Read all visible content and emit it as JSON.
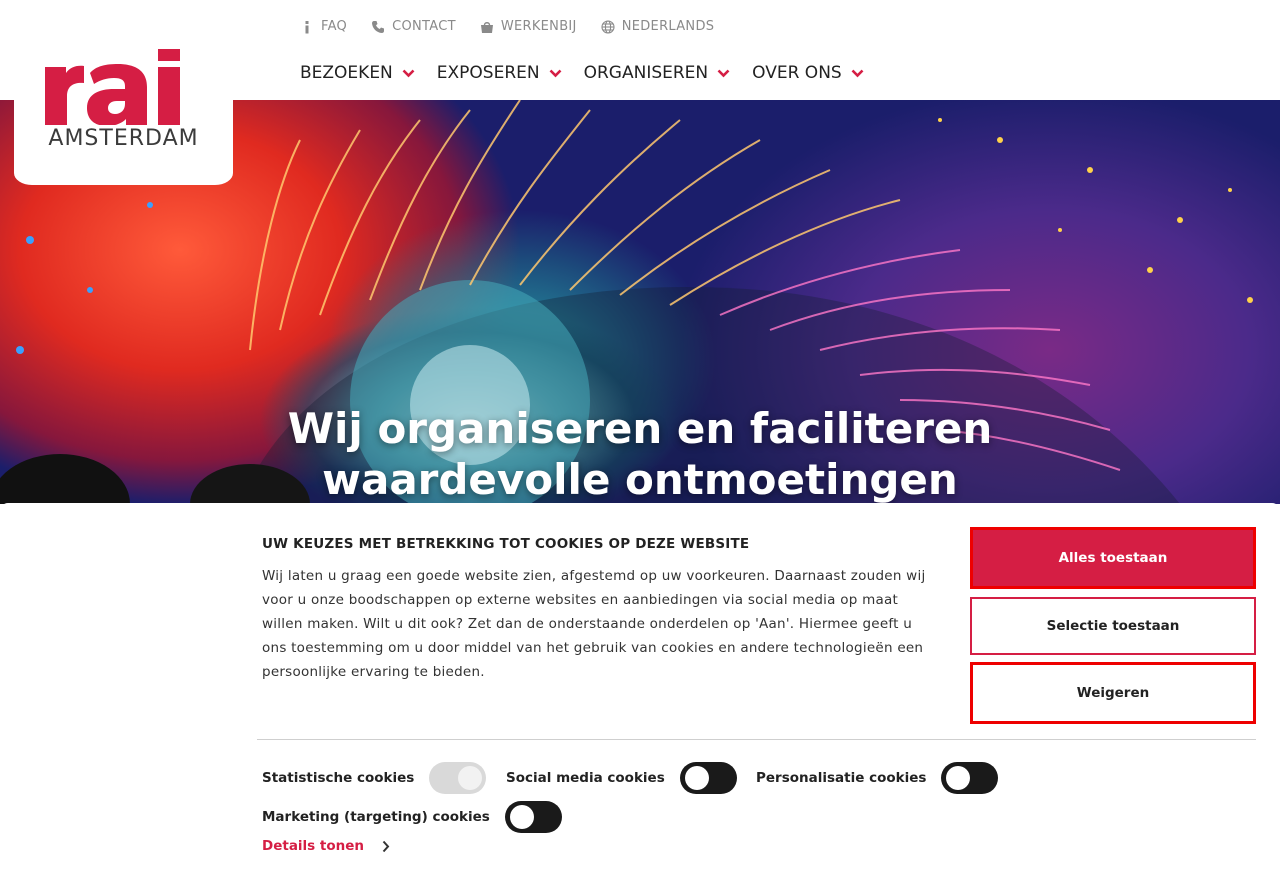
{
  "utility_nav": [
    {
      "label": "FAQ",
      "icon": "info-icon"
    },
    {
      "label": "CONTACT",
      "icon": "phone-icon"
    },
    {
      "label": "WERKENBIJ",
      "icon": "shopping-bag-icon"
    },
    {
      "label": "NEDERLANDS",
      "icon": "globe-icon"
    }
  ],
  "main_nav": [
    {
      "label": "BEZOEKEN"
    },
    {
      "label": "EXPOSEREN"
    },
    {
      "label": "ORGANISEREN"
    },
    {
      "label": "OVER ONS"
    }
  ],
  "logo": {
    "mark": "rai",
    "sub": "AMSTERDAM"
  },
  "hero": {
    "title_line1": "Wij organiseren en faciliteren",
    "title_line2": "waardevolle ontmoetingen"
  },
  "cookie": {
    "title": "UW KEUZES MET BETREKKING TOT COOKIES OP DEZE WEBSITE",
    "text": "Wij laten u graag een goede website zien, afgestemd op uw voorkeuren. Daarnaast zouden wij voor u onze boodschappen op externe websites en aanbiedingen via social media op maat willen maken. Wilt u dit ook? Zet dan de onderstaande onderdelen op 'Aan'. Hiermee geeft u ons toestemming om u door middel van het gebruik van cookies en andere technologieën een persoonlijke ervaring te bieden.",
    "btn_all": "Alles toestaan",
    "btn_selection": "Selectie toestaan",
    "btn_refuse": "Weigeren",
    "toggles": {
      "statistics": "Statistische cookies",
      "social": "Social media cookies",
      "personal": "Personalisatie cookies",
      "marketing": "Marketing (targeting) cookies"
    },
    "details": "Details tonen"
  },
  "colors": {
    "brand": "#d51e44",
    "text": "#222222",
    "muted": "#8a8a8a"
  }
}
